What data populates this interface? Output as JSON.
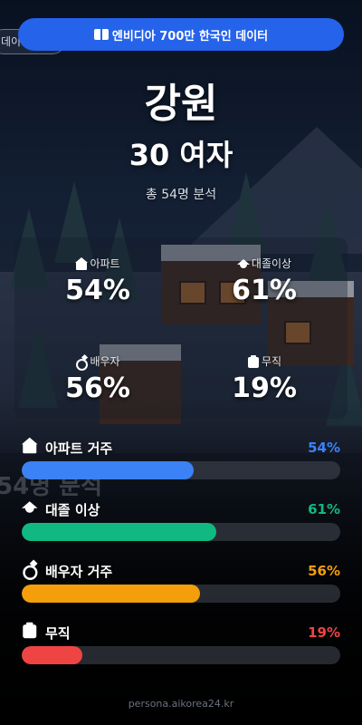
{
  "banner": {
    "icon": "book-icon",
    "text": "엔비디아 700만 한국인 데이터"
  },
  "region": "강원",
  "subtitle": "30 여자",
  "count_text": "총 54명 분석",
  "stats": [
    {
      "icon": "house-icon",
      "label": "아파트",
      "value": "54%"
    },
    {
      "icon": "cap-icon",
      "label": "대졸이상",
      "value": "61%"
    },
    {
      "icon": "ring-icon",
      "label": "배우자",
      "value": "56%"
    },
    {
      "icon": "clipboard-icon",
      "label": "무직",
      "value": "19%"
    }
  ],
  "bars": [
    {
      "icon": "house-icon",
      "label": "아파트 거주",
      "percent_text": "54%",
      "value": 0.54,
      "color": "#3b82f6"
    },
    {
      "icon": "cap-icon",
      "label": "대졸 이상",
      "percent_text": "61%",
      "value": 0.61,
      "color": "#10b981"
    },
    {
      "icon": "ring-icon",
      "label": "배우자 거주",
      "percent_text": "56%",
      "value": 0.56,
      "color": "#f59e0b"
    },
    {
      "icon": "clipboard-icon",
      "label": "무직",
      "percent_text": "19%",
      "value": 0.19,
      "color": "#ef4444"
    }
  ],
  "background": {
    "ghost_pill": "데이",
    "ghost_text": "54명 분석"
  },
  "footer": "persona.aikorea24.kr"
}
